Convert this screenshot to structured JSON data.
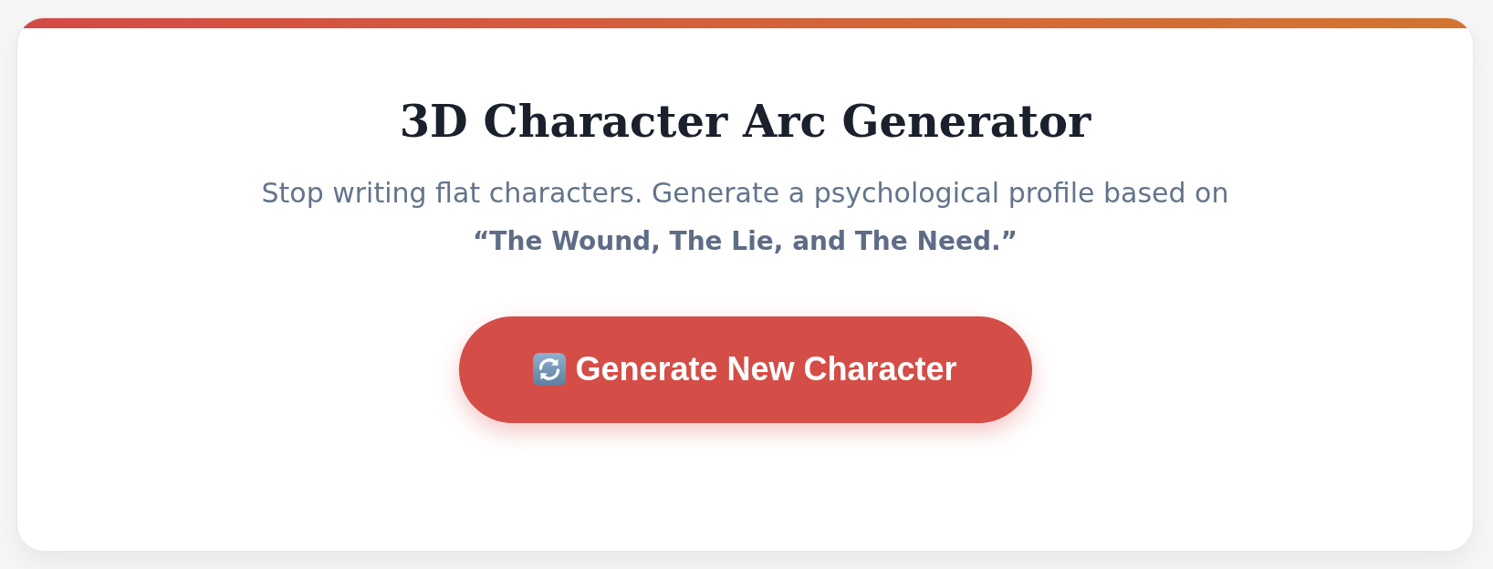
{
  "header": {
    "title": "3D Character Arc Generator",
    "subtitle": "Stop writing flat characters. Generate a psychological profile based on **“The Wound, The Lie, and The Need.”**"
  },
  "action": {
    "label": "Generate New Character"
  }
}
